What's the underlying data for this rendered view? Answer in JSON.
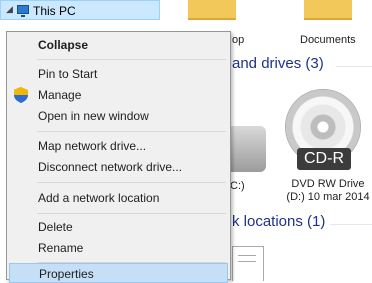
{
  "tree": {
    "label": "This PC"
  },
  "folders": [
    {
      "label": "op"
    },
    {
      "label": "Documents"
    }
  ],
  "groups": {
    "devices": "and drives (3)",
    "network": "k locations (1)"
  },
  "drives": {
    "drive_c_label": "C:)",
    "dvd": {
      "badge": "CD-R",
      "line1": "DVD RW Drive",
      "line2": "(D:) 10 mar 2014"
    }
  },
  "context_menu": {
    "items": [
      {
        "label": "Collapse"
      },
      {
        "label": "Pin to Start"
      },
      {
        "label": "Manage"
      },
      {
        "label": "Open in new window"
      },
      {
        "label": "Map network drive..."
      },
      {
        "label": "Disconnect network drive..."
      },
      {
        "label": "Add a network location"
      },
      {
        "label": "Delete"
      },
      {
        "label": "Rename"
      },
      {
        "label": "Properties"
      }
    ],
    "highlighted_item": "Properties"
  },
  "colors": {
    "selection": "#cce8ff",
    "menu_background": "#f0f0f0",
    "menu_highlight": "#c5dff7",
    "group_header": "#1e3287"
  }
}
